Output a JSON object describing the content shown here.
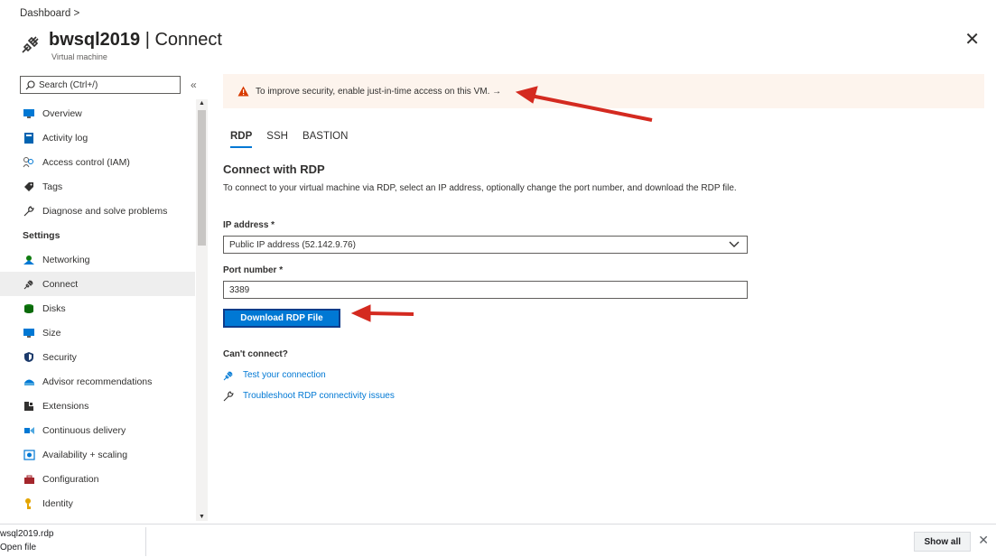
{
  "breadcrumb": {
    "dashboard": "Dashboard >"
  },
  "header": {
    "resource_name": "bwsql2019",
    "separator_title": " | Connect",
    "subtitle": "Virtual machine",
    "close_glyph": "✕"
  },
  "sidebar": {
    "search_placeholder": "Search (Ctrl+/)",
    "collapse_glyph": "«",
    "items": [
      {
        "label": "Overview",
        "icon": "monitor-icon"
      },
      {
        "label": "Activity log",
        "icon": "book-icon"
      },
      {
        "label": "Access control (IAM)",
        "icon": "people-icon"
      },
      {
        "label": "Tags",
        "icon": "tag-icon"
      },
      {
        "label": "Diagnose and solve problems",
        "icon": "wrench-icon"
      }
    ],
    "section_header": "Settings",
    "settings_items": [
      {
        "label": "Networking",
        "icon": "network-icon"
      },
      {
        "label": "Connect",
        "icon": "plug-icon"
      },
      {
        "label": "Disks",
        "icon": "disk-icon"
      },
      {
        "label": "Size",
        "icon": "monitor-icon"
      },
      {
        "label": "Security",
        "icon": "shield-icon"
      },
      {
        "label": "Advisor recommendations",
        "icon": "advisor-icon"
      },
      {
        "label": "Extensions",
        "icon": "extensions-icon"
      },
      {
        "label": "Continuous delivery",
        "icon": "delivery-icon"
      },
      {
        "label": "Availability + scaling",
        "icon": "availability-icon"
      },
      {
        "label": "Configuration",
        "icon": "toolbox-icon"
      },
      {
        "label": "Identity",
        "icon": "key-icon"
      }
    ]
  },
  "banner": {
    "text": "To improve security, enable just-in-time access on this VM. →"
  },
  "tabs": [
    "RDP",
    "SSH",
    "BASTION"
  ],
  "connect": {
    "title": "Connect with RDP",
    "description": "To connect to your virtual machine via RDP, select an IP address, optionally change the port number, and download the RDP file.",
    "ip_label": "IP address *",
    "ip_value": "Public IP address (52.142.9.76)",
    "port_label": "Port number *",
    "port_value": "3389",
    "download_button": "Download RDP File",
    "cant_connect": "Can't connect?",
    "test_link": "Test your connection",
    "troubleshoot_link": "Troubleshoot RDP connectivity issues"
  },
  "download_bar": {
    "file_name": "wsql2019.rdp",
    "status": "Open file",
    "show_all": "Show all",
    "close_glyph": "✕"
  },
  "colors": {
    "accent": "#0078d4",
    "banner_bg": "#fdf4ed",
    "warning": "#d83b01",
    "annotation_arrow": "#d42a20"
  }
}
